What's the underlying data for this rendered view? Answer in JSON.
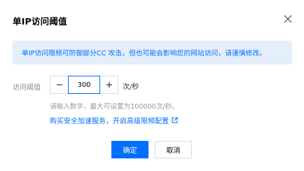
{
  "dialog": {
    "title": "单IP访问阈值",
    "close_icon": "close-icon"
  },
  "notice": {
    "text": "单IP访问限频可防御部分CC 攻击，但也可能会影响您的网站访问，请谨慎修改。",
    "color": "#006eff",
    "background": "#e5eefb"
  },
  "form": {
    "label": "访问阈值",
    "value": "300",
    "unit": "次/秒",
    "hint": "请输入数字，最大可设置为100000次/秒。",
    "link_text": "购买安全加速服务，开启高级限频配置",
    "link_icon": "external-link-icon"
  },
  "footer": {
    "ok_label": "确定",
    "cancel_label": "取消",
    "accent_color": "#006eff"
  }
}
